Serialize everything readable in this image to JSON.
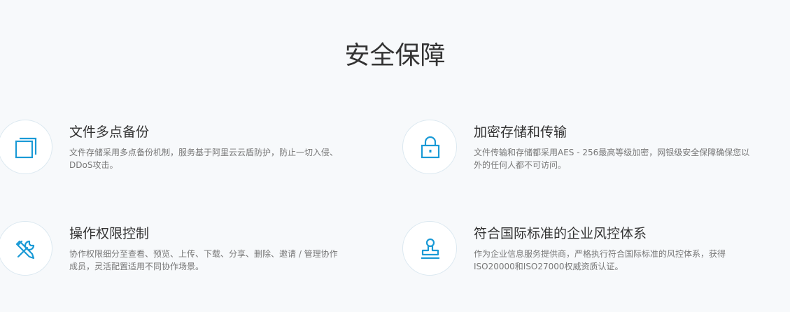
{
  "section": {
    "title": "安全保障"
  },
  "features": [
    {
      "icon": "copy-layers-icon",
      "title": "文件多点备份",
      "desc": "文件存储采用多点备份机制，服务基于阿里云云盾防护，防止一切入侵、DDoS攻击。"
    },
    {
      "icon": "lock-icon",
      "title": "加密存储和传输",
      "desc": "文件传输和存储都采用AES - 256最高等级加密，网银级安全保障确保您以外的任何人都不可访问。"
    },
    {
      "icon": "wrench-screwdriver-icon",
      "title": "操作权限控制",
      "desc": "协作权限细分至查看、预览、上传、下载、分享、删除、邀请 / 管理协作成员，灵活配置适用不同协作场景。"
    },
    {
      "icon": "stamp-icon",
      "title": "符合国际标准的企业风控体系",
      "desc": "作为企业信息服务提供商，严格执行符合国际标准的风控体系，获得ISO20000和ISO27000权威资质认证。"
    }
  ],
  "colors": {
    "accent": "#1a9ad6",
    "background": "#f7f9fb"
  }
}
